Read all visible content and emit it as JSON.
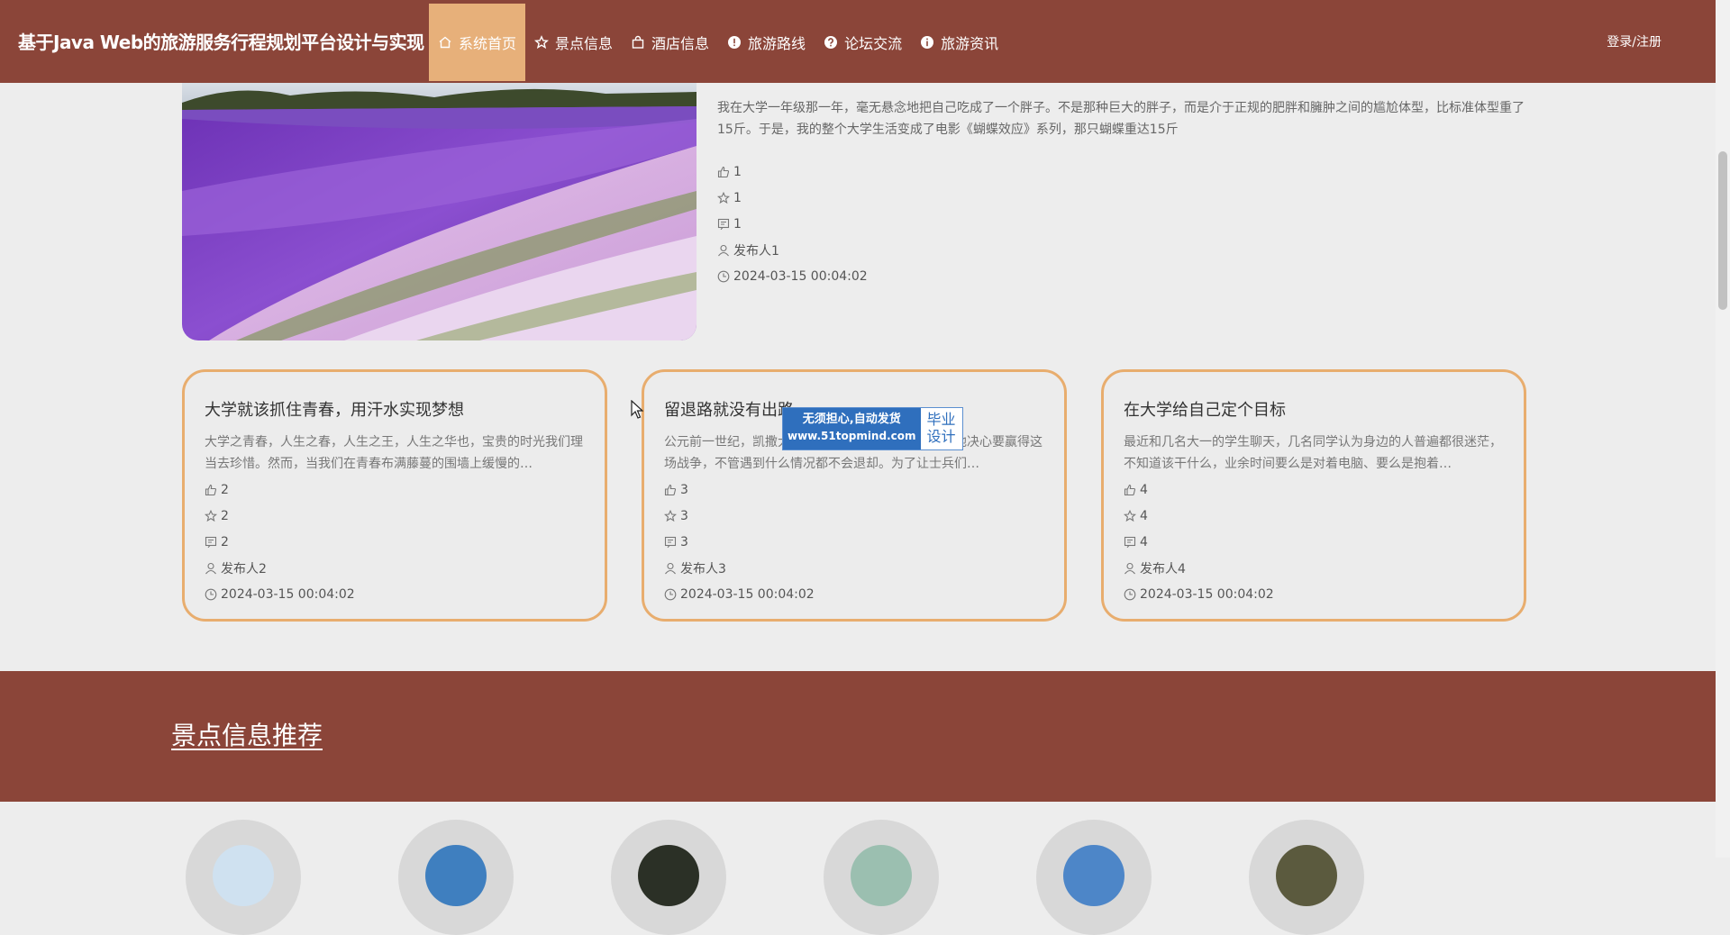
{
  "header": {
    "site_title": "基于Java Web的旅游服务行程规划平台设计与实现",
    "nav": [
      {
        "label": "系统首页",
        "icon": "home-icon",
        "active": true
      },
      {
        "label": "景点信息",
        "icon": "star-icon",
        "active": false
      },
      {
        "label": "酒店信息",
        "icon": "bag-icon",
        "active": false
      },
      {
        "label": "旅游路线",
        "icon": "alert-circle-icon",
        "active": false
      },
      {
        "label": "论坛交流",
        "icon": "question-circle-icon",
        "active": false
      },
      {
        "label": "旅游资讯",
        "icon": "info-circle-icon",
        "active": false
      }
    ],
    "login_label": "登录/注册"
  },
  "featured": {
    "description": "我在大学一年级那一年，毫无悬念地把自己吃成了一个胖子。不是那种巨大的胖子，而是介于正规的肥胖和臃肿之间的尴尬体型，比标准体型重了15斤。于是，我的整个大学生活变成了电影《蝴蝶效应》系列，那只蝴蝶重达15斤",
    "likes": "1",
    "favorites": "1",
    "comments": "1",
    "author": "发布人1",
    "time": "2024-03-15 00:04:02"
  },
  "cards": [
    {
      "title": "大学就该抓住青春，用汗水实现梦想",
      "description": "大学之青春，人生之春，人生之王，人生之华也，宝贵的时光我们理当去珍惜。然而，当我们在青春布满藤蔓的围墙上缓慢的…",
      "likes": "2",
      "favorites": "2",
      "comments": "2",
      "author": "发布人2",
      "time": "2024-03-15 00:04:02"
    },
    {
      "title": "留退路就没有出路",
      "description": "公元前一世纪，凯撒大帝统领他的军队抵达英格兰，他决心要赢得这场战争，不管遇到什么情况都不会退却。为了让士兵们…",
      "likes": "3",
      "favorites": "3",
      "comments": "3",
      "author": "发布人3",
      "time": "2024-03-15 00:04:02"
    },
    {
      "title": "在大学给自己定个目标",
      "description": "最近和几名大一的学生聊天，几名同学认为身边的人普遍都很迷茫，不知道该干什么，业余时间要么是对着电脑、要么是抱着…",
      "likes": "4",
      "favorites": "4",
      "comments": "4",
      "author": "发布人4",
      "time": "2024-03-15 00:04:02"
    }
  ],
  "watermark": {
    "line1": "无须担心,自动发货",
    "line2": "www.51topmind.com",
    "right1": "毕业",
    "right2": "设计"
  },
  "recommend": {
    "title": "景点信息推荐"
  },
  "colors": {
    "brand": "#8b4539",
    "accent": "#e8ad6e"
  }
}
